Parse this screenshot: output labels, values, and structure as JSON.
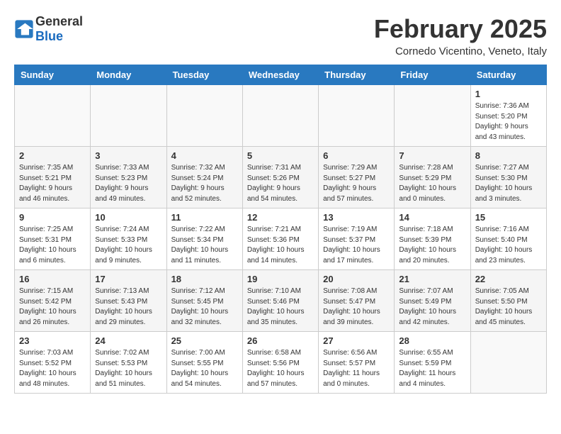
{
  "header": {
    "logo_general": "General",
    "logo_blue": "Blue",
    "title": "February 2025",
    "subtitle": "Cornedo Vicentino, Veneto, Italy"
  },
  "calendar": {
    "columns": [
      "Sunday",
      "Monday",
      "Tuesday",
      "Wednesday",
      "Thursday",
      "Friday",
      "Saturday"
    ],
    "weeks": [
      [
        {
          "day": "",
          "info": ""
        },
        {
          "day": "",
          "info": ""
        },
        {
          "day": "",
          "info": ""
        },
        {
          "day": "",
          "info": ""
        },
        {
          "day": "",
          "info": ""
        },
        {
          "day": "",
          "info": ""
        },
        {
          "day": "1",
          "info": "Sunrise: 7:36 AM\nSunset: 5:20 PM\nDaylight: 9 hours and 43 minutes."
        }
      ],
      [
        {
          "day": "2",
          "info": "Sunrise: 7:35 AM\nSunset: 5:21 PM\nDaylight: 9 hours and 46 minutes."
        },
        {
          "day": "3",
          "info": "Sunrise: 7:33 AM\nSunset: 5:23 PM\nDaylight: 9 hours and 49 minutes."
        },
        {
          "day": "4",
          "info": "Sunrise: 7:32 AM\nSunset: 5:24 PM\nDaylight: 9 hours and 52 minutes."
        },
        {
          "day": "5",
          "info": "Sunrise: 7:31 AM\nSunset: 5:26 PM\nDaylight: 9 hours and 54 minutes."
        },
        {
          "day": "6",
          "info": "Sunrise: 7:29 AM\nSunset: 5:27 PM\nDaylight: 9 hours and 57 minutes."
        },
        {
          "day": "7",
          "info": "Sunrise: 7:28 AM\nSunset: 5:29 PM\nDaylight: 10 hours and 0 minutes."
        },
        {
          "day": "8",
          "info": "Sunrise: 7:27 AM\nSunset: 5:30 PM\nDaylight: 10 hours and 3 minutes."
        }
      ],
      [
        {
          "day": "9",
          "info": "Sunrise: 7:25 AM\nSunset: 5:31 PM\nDaylight: 10 hours and 6 minutes."
        },
        {
          "day": "10",
          "info": "Sunrise: 7:24 AM\nSunset: 5:33 PM\nDaylight: 10 hours and 9 minutes."
        },
        {
          "day": "11",
          "info": "Sunrise: 7:22 AM\nSunset: 5:34 PM\nDaylight: 10 hours and 11 minutes."
        },
        {
          "day": "12",
          "info": "Sunrise: 7:21 AM\nSunset: 5:36 PM\nDaylight: 10 hours and 14 minutes."
        },
        {
          "day": "13",
          "info": "Sunrise: 7:19 AM\nSunset: 5:37 PM\nDaylight: 10 hours and 17 minutes."
        },
        {
          "day": "14",
          "info": "Sunrise: 7:18 AM\nSunset: 5:39 PM\nDaylight: 10 hours and 20 minutes."
        },
        {
          "day": "15",
          "info": "Sunrise: 7:16 AM\nSunset: 5:40 PM\nDaylight: 10 hours and 23 minutes."
        }
      ],
      [
        {
          "day": "16",
          "info": "Sunrise: 7:15 AM\nSunset: 5:42 PM\nDaylight: 10 hours and 26 minutes."
        },
        {
          "day": "17",
          "info": "Sunrise: 7:13 AM\nSunset: 5:43 PM\nDaylight: 10 hours and 29 minutes."
        },
        {
          "day": "18",
          "info": "Sunrise: 7:12 AM\nSunset: 5:45 PM\nDaylight: 10 hours and 32 minutes."
        },
        {
          "day": "19",
          "info": "Sunrise: 7:10 AM\nSunset: 5:46 PM\nDaylight: 10 hours and 35 minutes."
        },
        {
          "day": "20",
          "info": "Sunrise: 7:08 AM\nSunset: 5:47 PM\nDaylight: 10 hours and 39 minutes."
        },
        {
          "day": "21",
          "info": "Sunrise: 7:07 AM\nSunset: 5:49 PM\nDaylight: 10 hours and 42 minutes."
        },
        {
          "day": "22",
          "info": "Sunrise: 7:05 AM\nSunset: 5:50 PM\nDaylight: 10 hours and 45 minutes."
        }
      ],
      [
        {
          "day": "23",
          "info": "Sunrise: 7:03 AM\nSunset: 5:52 PM\nDaylight: 10 hours and 48 minutes."
        },
        {
          "day": "24",
          "info": "Sunrise: 7:02 AM\nSunset: 5:53 PM\nDaylight: 10 hours and 51 minutes."
        },
        {
          "day": "25",
          "info": "Sunrise: 7:00 AM\nSunset: 5:55 PM\nDaylight: 10 hours and 54 minutes."
        },
        {
          "day": "26",
          "info": "Sunrise: 6:58 AM\nSunset: 5:56 PM\nDaylight: 10 hours and 57 minutes."
        },
        {
          "day": "27",
          "info": "Sunrise: 6:56 AM\nSunset: 5:57 PM\nDaylight: 11 hours and 0 minutes."
        },
        {
          "day": "28",
          "info": "Sunrise: 6:55 AM\nSunset: 5:59 PM\nDaylight: 11 hours and 4 minutes."
        },
        {
          "day": "",
          "info": ""
        }
      ]
    ]
  }
}
